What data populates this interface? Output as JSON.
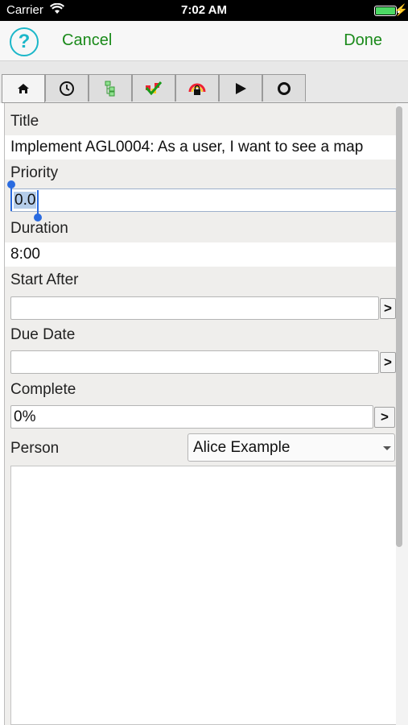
{
  "status_bar": {
    "carrier": "Carrier",
    "time": "7:02 AM",
    "wifi_icon": "wifi-icon",
    "battery_icon": "battery-icon",
    "battery_color": "#4cd964"
  },
  "nav": {
    "help": "?",
    "cancel": "Cancel",
    "done": "Done",
    "accent_color": "#1a8a1a",
    "help_color": "#1cb7c9"
  },
  "tabs": [
    {
      "icon": "home-icon",
      "glyph": "⌂",
      "active": true
    },
    {
      "icon": "clock-icon",
      "glyph": "◷",
      "active": false
    },
    {
      "icon": "hierarchy-icon",
      "glyph": "⊞",
      "active": false
    },
    {
      "icon": "checklist-icon",
      "glyph": "✔",
      "active": false
    },
    {
      "icon": "lock-icon",
      "glyph": "🔒",
      "active": false
    },
    {
      "icon": "play-icon",
      "glyph": "▶",
      "active": false
    },
    {
      "icon": "circle-icon",
      "glyph": "○",
      "active": false
    }
  ],
  "form": {
    "title_label": "Title",
    "title_value": "Implement AGL0004: As a user, I want to see a map",
    "priority_label": "Priority",
    "priority_value": "0.0",
    "duration_label": "Duration",
    "duration_value": "8:00",
    "start_after_label": "Start After",
    "start_after_value": "",
    "start_after_button": ">",
    "due_date_label": "Due Date",
    "due_date_value": "",
    "due_date_button": ">",
    "complete_label": "Complete",
    "complete_value": "0%",
    "complete_button": ">",
    "person_label": "Person",
    "person_value": "Alice Example",
    "notes_value": ""
  }
}
